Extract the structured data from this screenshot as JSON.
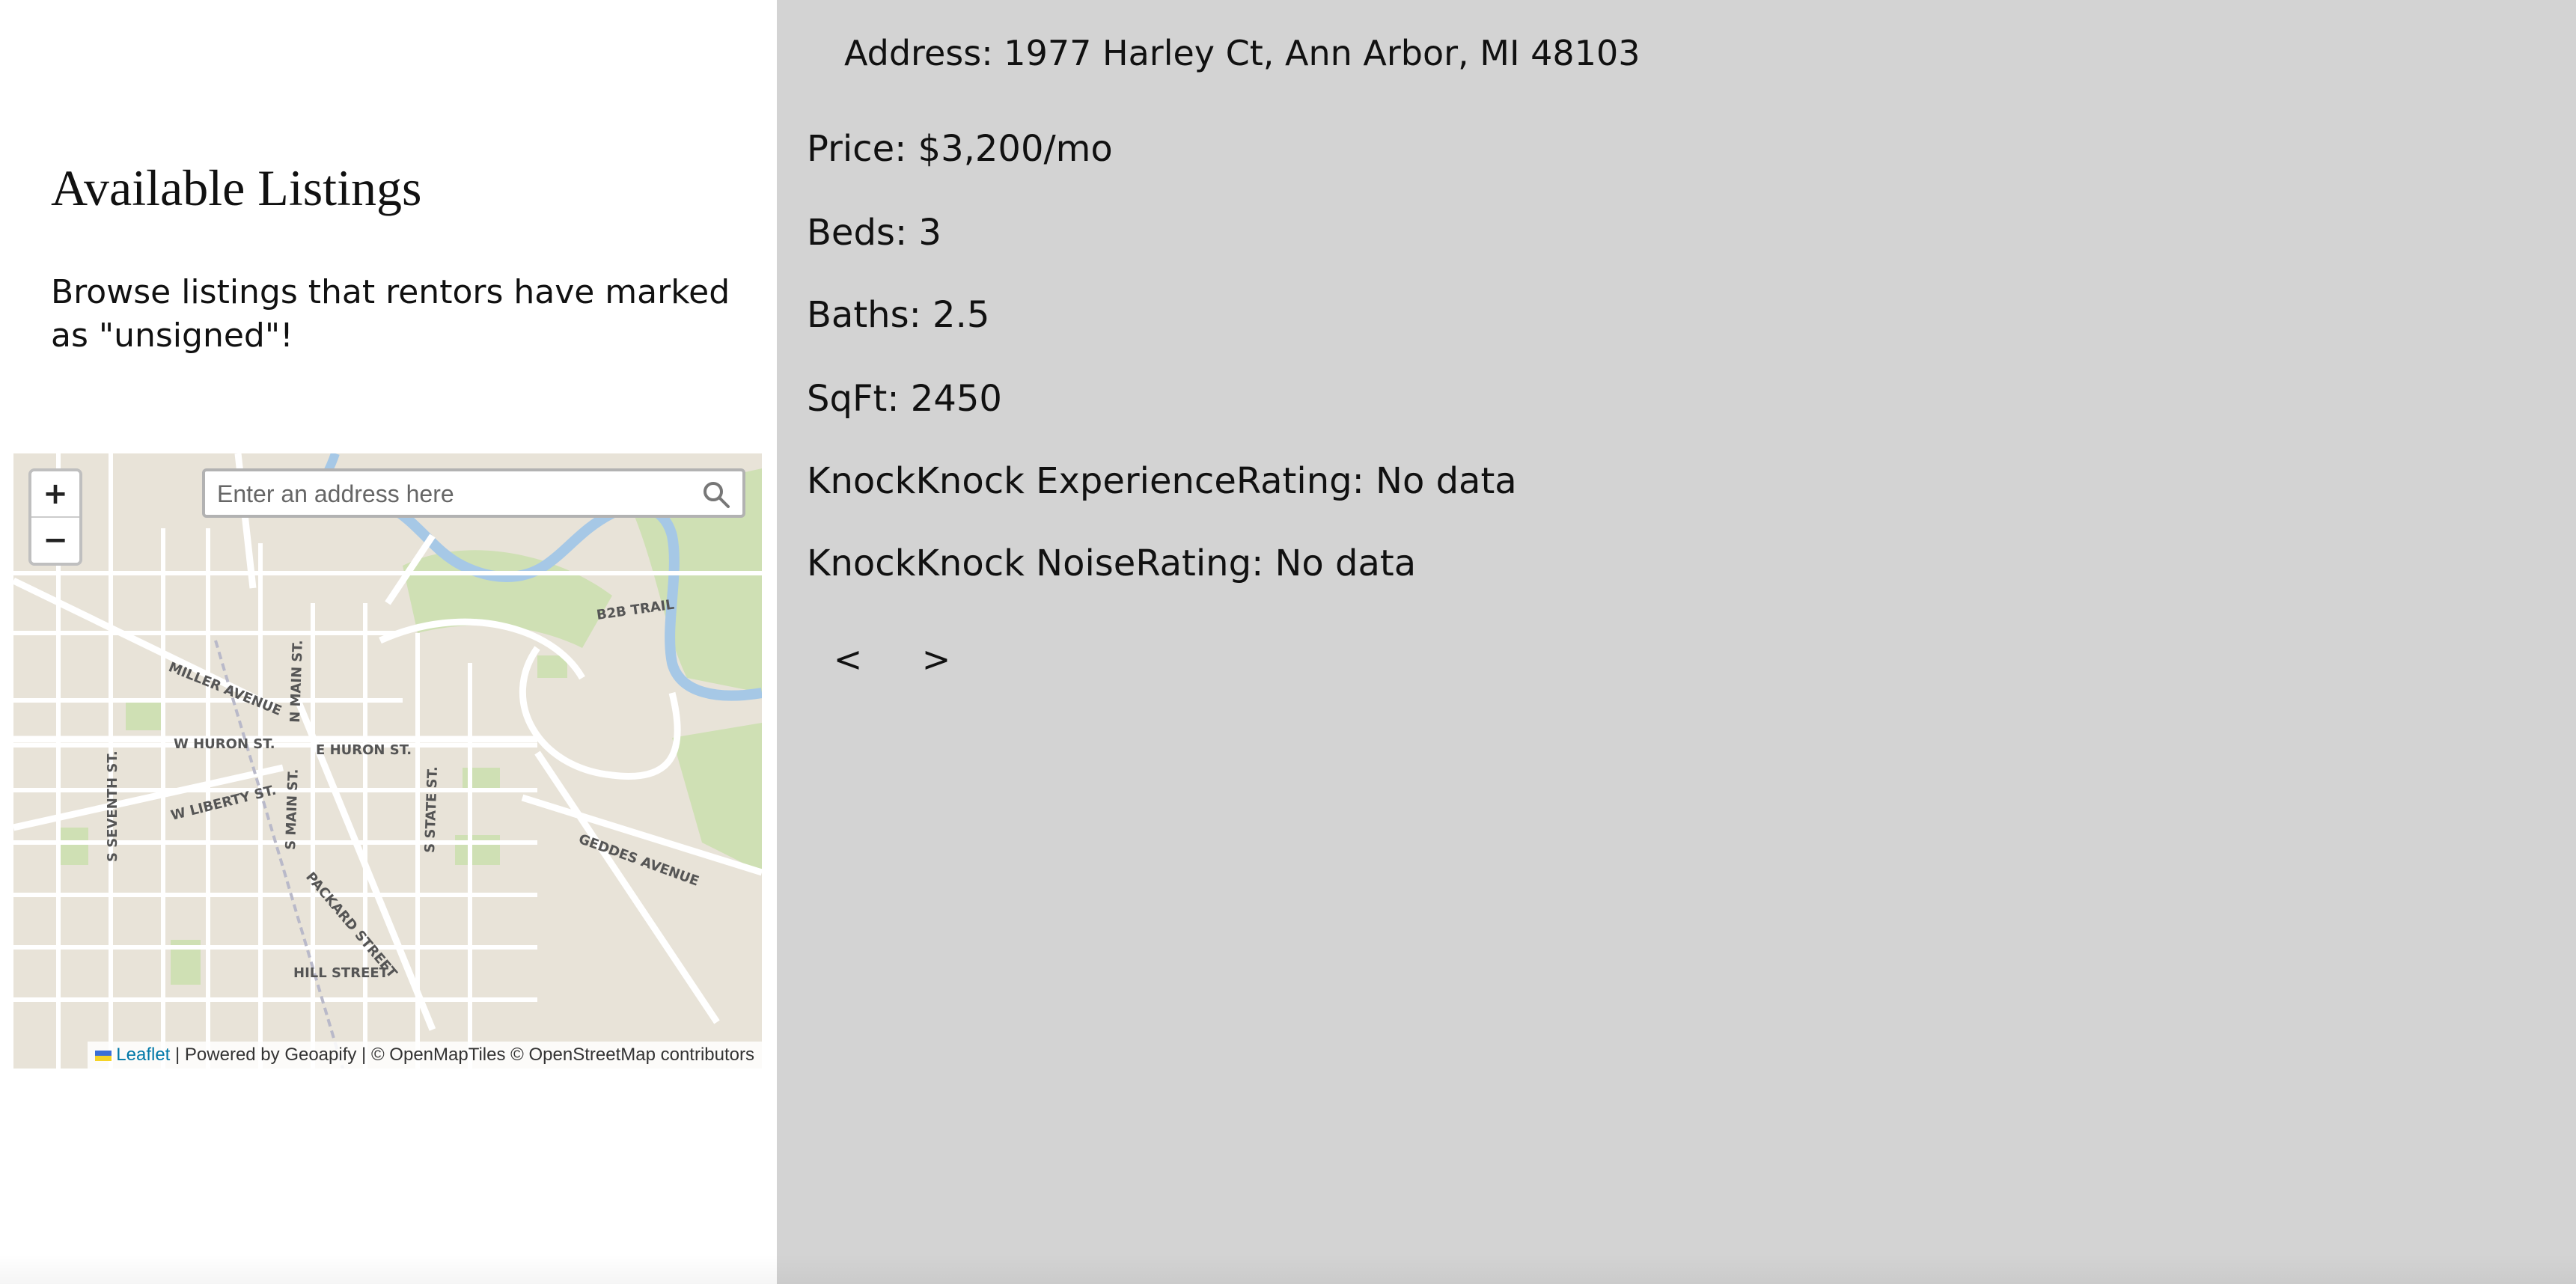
{
  "left": {
    "title": "Available Listings",
    "subtitle": "Browse listings that rentors have marked as \"unsigned\"!"
  },
  "map": {
    "zoom_in_label": "+",
    "zoom_out_label": "−",
    "search_placeholder": "Enter an address here",
    "search_icon": "search-icon",
    "street_labels": {
      "b2b_trail": "B2B TRAIL",
      "miller": "MILLER AVENUE",
      "n_main": "N MAIN ST.",
      "w_huron": "W HURON ST.",
      "e_huron": "E HURON ST.",
      "w_liberty": "W LIBERTY ST.",
      "s_seventh": "S SEVENTH ST.",
      "s_main": "S MAIN ST.",
      "s_state": "S STATE ST.",
      "geddes": "GEDDES AVENUE",
      "packard": "PACKARD STREET",
      "hill": "HILL STREET"
    },
    "attribution": {
      "leaflet": "Leaflet",
      "rest": " | Powered by Geoapify | © OpenMapTiles © OpenStreetMap contributors"
    },
    "colors": {
      "land": "#e8e3d8",
      "park": "#cfe0b4",
      "water": "#a6c8e6",
      "road": "#ffffff",
      "flag_top": "#3b6fd6",
      "flag_bottom": "#f5d327"
    }
  },
  "listing": {
    "address": "Address: 1977 Harley Ct, Ann Arbor, MI 48103",
    "price": "Price: $3,200/mo",
    "beds": "Beds: 3",
    "baths": "Baths: 2.5",
    "sqft": "SqFt: 2450",
    "experience_rating": "KnockKnock ExperienceRating: No data",
    "noise_rating": "KnockKnock NoiseRating: No data",
    "prev_label": "<",
    "next_label": ">"
  },
  "colors": {
    "right_panel_bg": "#d3d3d3",
    "left_panel_bg": "#ffffff"
  }
}
